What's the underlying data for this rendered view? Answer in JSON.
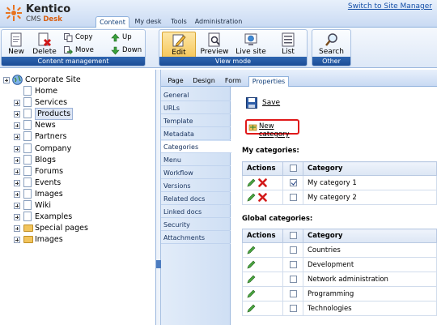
{
  "app": {
    "logo_line1": "Kentico",
    "logo_line2_a": "CMS",
    "logo_line2_b": "Desk",
    "switch_link": "Switch to Site Manager"
  },
  "top_tabs": [
    {
      "label": "Content",
      "active": true
    },
    {
      "label": "My desk"
    },
    {
      "label": "Tools"
    },
    {
      "label": "Administration"
    }
  ],
  "toolbar": {
    "content_management": {
      "title": "Content management",
      "new_label": "New",
      "delete_label": "Delete",
      "copy_label": "Copy",
      "move_label": "Move",
      "up_label": "Up",
      "down_label": "Down"
    },
    "view_mode": {
      "title": "View mode",
      "edit_label": "Edit",
      "preview_label": "Preview",
      "live_site_label": "Live site",
      "list_label": "List"
    },
    "other": {
      "title": "Other",
      "search_label": "Search"
    }
  },
  "tree": {
    "root": "Corporate Site",
    "items": [
      {
        "label": "Home",
        "type": "doc",
        "expandable": false
      },
      {
        "label": "Services",
        "type": "doc",
        "expandable": true
      },
      {
        "label": "Products",
        "type": "doc",
        "expandable": true,
        "selected": true
      },
      {
        "label": "News",
        "type": "doc",
        "expandable": true
      },
      {
        "label": "Partners",
        "type": "doc",
        "expandable": true
      },
      {
        "label": "Company",
        "type": "doc",
        "expandable": true
      },
      {
        "label": "Blogs",
        "type": "doc",
        "expandable": true
      },
      {
        "label": "Forums",
        "type": "doc",
        "expandable": true
      },
      {
        "label": "Events",
        "type": "doc",
        "expandable": true
      },
      {
        "label": "Images",
        "type": "doc",
        "expandable": true
      },
      {
        "label": "Wiki",
        "type": "doc",
        "expandable": true
      },
      {
        "label": "Examples",
        "type": "doc",
        "expandable": true
      },
      {
        "label": "Special pages",
        "type": "folder",
        "expandable": true
      },
      {
        "label": "Images",
        "type": "folder",
        "expandable": true
      }
    ]
  },
  "content_tabs": [
    {
      "label": "Page"
    },
    {
      "label": "Design"
    },
    {
      "label": "Form"
    },
    {
      "label": "Properties",
      "active": true
    }
  ],
  "property_menu": [
    {
      "label": "General"
    },
    {
      "label": "URLs"
    },
    {
      "label": "Template"
    },
    {
      "label": "Metadata"
    },
    {
      "label": "Categories",
      "active": true
    },
    {
      "label": "Menu"
    },
    {
      "label": "Workflow"
    },
    {
      "label": "Versions"
    },
    {
      "label": "Related docs"
    },
    {
      "label": "Linked docs"
    },
    {
      "label": "Security"
    },
    {
      "label": "Attachments"
    }
  ],
  "main": {
    "save_label": "Save",
    "new_category_label": "New category",
    "my_categories_heading": "My categories:",
    "global_categories_heading": "Global categories:",
    "col_actions": "Actions",
    "col_category": "Category",
    "my_categories": [
      {
        "name": "My category 1",
        "checked": true
      },
      {
        "name": "My category 2",
        "checked": false
      }
    ],
    "global_categories": [
      {
        "name": "Countries",
        "checked": false
      },
      {
        "name": "Development",
        "checked": false
      },
      {
        "name": "Network administration",
        "checked": false
      },
      {
        "name": "Programming",
        "checked": false
      },
      {
        "name": "Technologies",
        "checked": false
      }
    ]
  },
  "colors": {
    "accent": "#1c4e97",
    "highlight": "#e0191a",
    "active_button": "#f6c75a"
  }
}
